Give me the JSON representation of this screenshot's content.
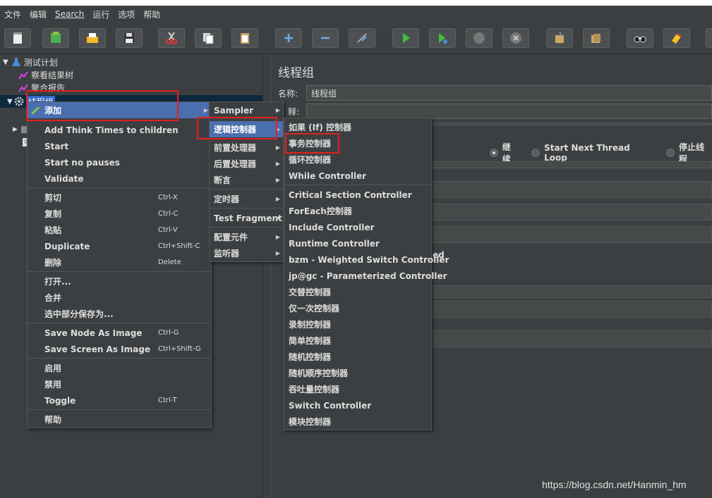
{
  "menubar": {
    "items": [
      "文件",
      "编辑",
      "Search",
      "运行",
      "选项",
      "帮助"
    ]
  },
  "toolbar": {
    "icons": [
      "new-icon",
      "template-icon",
      "open-icon",
      "save-icon",
      "cut-icon",
      "copy-icon",
      "paste-icon",
      "expand-icon",
      "collapse-icon",
      "toggle-icon",
      "start-icon",
      "start-no-pause-icon",
      "stop-icon",
      "shutdown-icon",
      "clear-icon",
      "clear-all-icon",
      "search-icon",
      "reset-search-icon"
    ]
  },
  "tree": {
    "test_plan": "测试计划",
    "view_results_tree": "察看结果树",
    "aggregate_report": "聚合报告",
    "thread_group": "线程组"
  },
  "right": {
    "title": "线程组",
    "name_label": "名称:",
    "name_value": "线程组",
    "comment_label": "释:",
    "radio_continue": "继续",
    "radio_next_loop": "Start Next Thread Loop",
    "radio_stop_thread": "停止线程",
    "partial_text": "ed"
  },
  "context_menu": {
    "items": [
      {
        "label": "添加",
        "shortcut": ""
      },
      {
        "label": "Add Think Times to children",
        "shortcut": ""
      },
      {
        "label": "Start",
        "shortcut": ""
      },
      {
        "label": "Start no pauses",
        "shortcut": ""
      },
      {
        "label": "Validate",
        "shortcut": ""
      },
      {
        "label": "剪切",
        "shortcut": "Ctrl-X"
      },
      {
        "label": "复制",
        "shortcut": "Ctrl-C"
      },
      {
        "label": "粘贴",
        "shortcut": "Ctrl-V"
      },
      {
        "label": "Duplicate",
        "shortcut": "Ctrl+Shift-C"
      },
      {
        "label": "删除",
        "shortcut": "Delete"
      },
      {
        "label": "打开...",
        "shortcut": ""
      },
      {
        "label": "合并",
        "shortcut": ""
      },
      {
        "label": "选中部分保存为...",
        "shortcut": ""
      },
      {
        "label": "Save Node As Image",
        "shortcut": "Ctrl-G"
      },
      {
        "label": "Save Screen As Image",
        "shortcut": "Ctrl+Shift-G"
      },
      {
        "label": "启用",
        "shortcut": ""
      },
      {
        "label": "禁用",
        "shortcut": ""
      },
      {
        "label": "Toggle",
        "shortcut": "Ctrl-T"
      },
      {
        "label": "帮助",
        "shortcut": ""
      }
    ]
  },
  "add_menu": {
    "items": [
      "Sampler",
      "逻辑控制器",
      "前置处理器",
      "后置处理器",
      "断言",
      "定时器",
      "Test Fragment",
      "配置元件",
      "监听器"
    ]
  },
  "logic_menu": {
    "items": [
      "如果 (If) 控制器",
      "事务控制器",
      "循环控制器",
      "While Controller",
      "Critical Section Controller",
      "ForEach控制器",
      "Include Controller",
      "Runtime Controller",
      "bzm - Weighted Switch Controller",
      "jp@gc - Parameterized Controller",
      "交替控制器",
      "仅一次控制器",
      "录制控制器",
      "简单控制器",
      "随机控制器",
      "随机顺序控制器",
      "吞吐量控制器",
      "Switch Controller",
      "模块控制器"
    ]
  },
  "watermark": "https://blog.csdn.net/Hanmin_hm"
}
